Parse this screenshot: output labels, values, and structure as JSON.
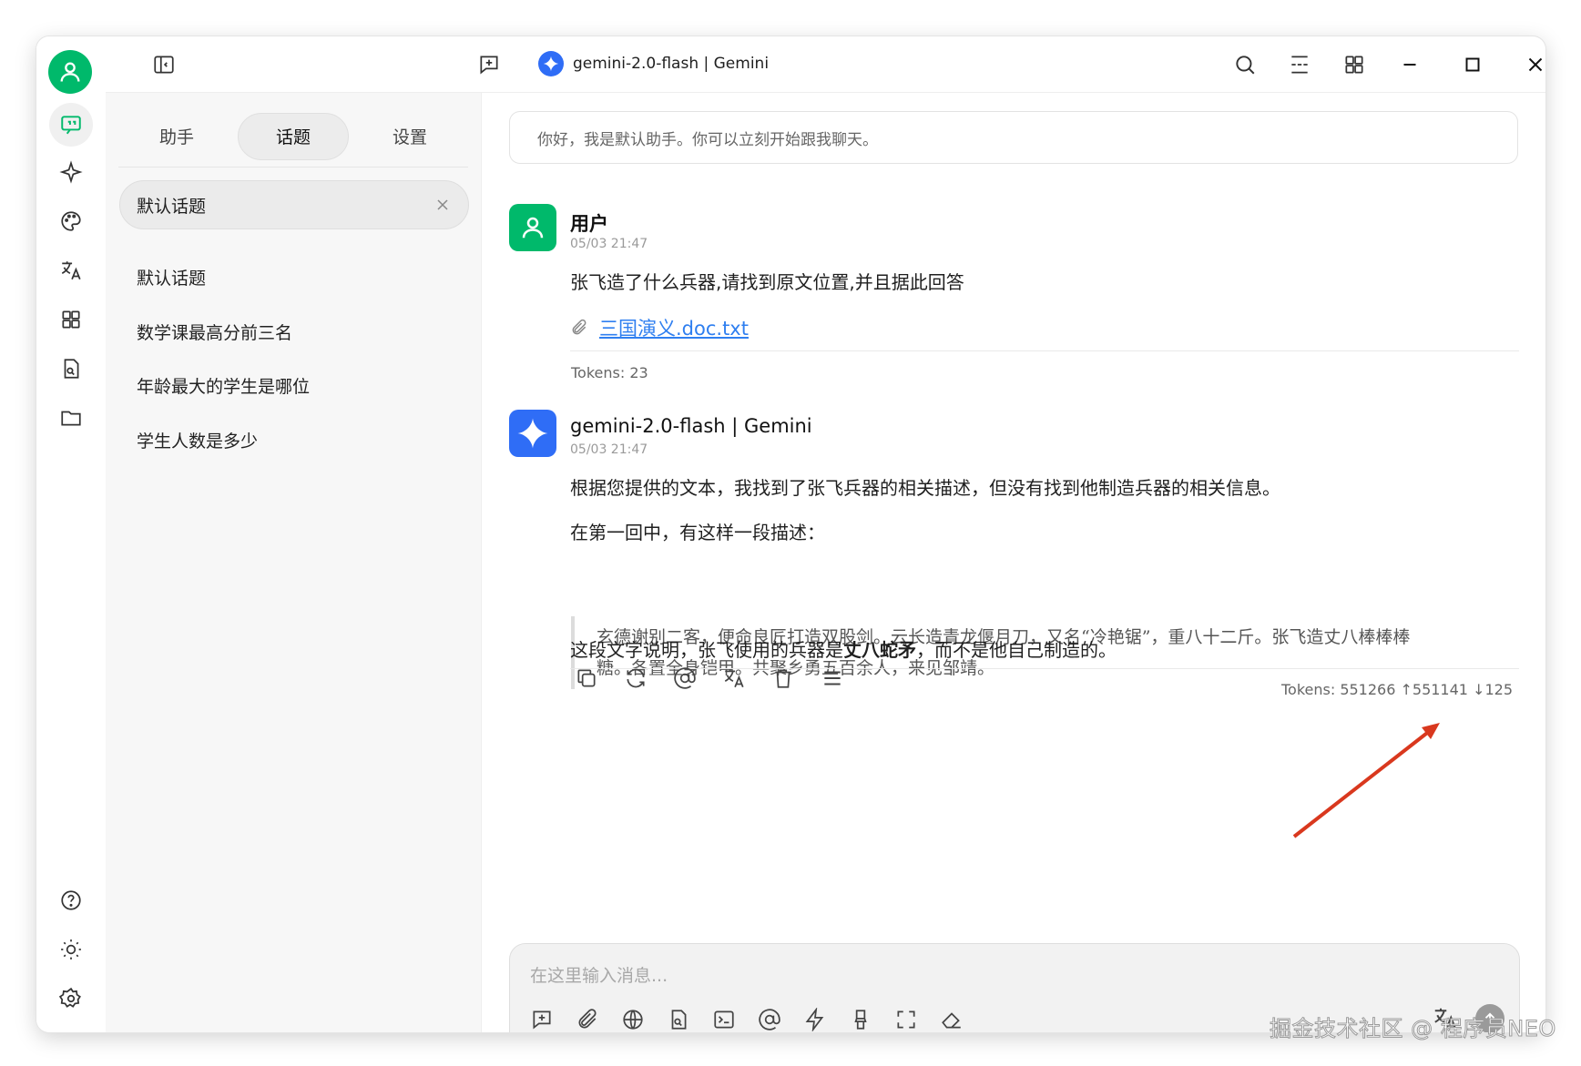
{
  "window": {
    "model_title": "gemini-2.0-flash | Gemini"
  },
  "sidebar": {
    "tabs": [
      {
        "label": "助手"
      },
      {
        "label": "话题"
      },
      {
        "label": "设置"
      }
    ],
    "active_topic": "默认话题",
    "topics": [
      "默认话题",
      "数学课最高分前三名",
      "年龄最大的学生是哪位",
      "学生人数是多少"
    ]
  },
  "chat": {
    "greeting": "你好，我是默认助手。你可以立刻开始跟我聊天。",
    "user_message": {
      "name": "用户",
      "time": "05/03 21:47",
      "text": "张飞造了什么兵器,请找到原文位置,并且据此回答",
      "attachment": "三国演义.doc.txt",
      "tokens": "Tokens: 23"
    },
    "ai_message": {
      "name": "gemini-2.0-flash | Gemini",
      "time": "05/03 21:47",
      "para1": "根据您提供的文本，我找到了张飞兵器的相关描述，但没有找到他制造兵器的相关信息。",
      "para2": "在第一回中，有这样一段描述：",
      "quote_line1": "玄德谢别二客，便命良匠打造双股剑。云长造青龙偃月刀，又名“冷艳锯”，重八十二斤。张飞造丈八棒棒棒",
      "quote_line2": "糖。各置全身铠甲。共聚乡勇五百余人，来见邹靖。",
      "para3_prefix": "这段文字说明，张飞使用的兵器是",
      "para3_bold": "丈八蛇矛",
      "para3_suffix": "，而不是他自己制造的。",
      "tokens": "Tokens: 551266 ↑551141 ↓125"
    },
    "composer": {
      "placeholder": "在这里输入消息..."
    }
  },
  "watermark": "掘金技术社区 @ 程序员NEO",
  "colors": {
    "accent": "#00b96b",
    "gemini": "#2f6df6",
    "link": "#2f7ff0",
    "annotation_arrow": "#d9381e"
  }
}
